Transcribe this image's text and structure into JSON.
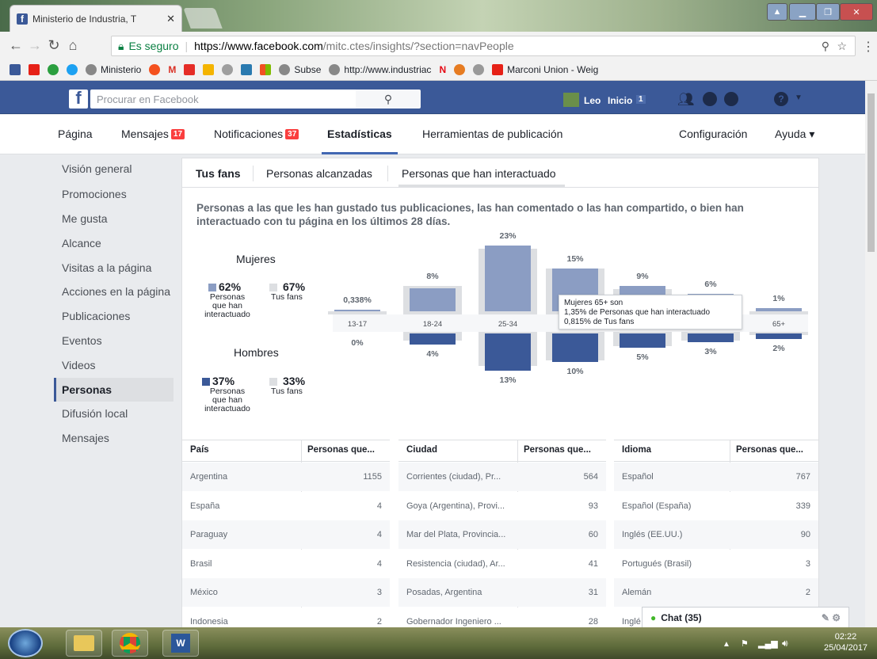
{
  "browser": {
    "tab_title": "Ministerio de Industria, T",
    "secure_label": "Es seguro",
    "url_host": "https://www.facebook.com",
    "url_rest": "/mitc.ctes/insights/?section=navPeople",
    "bookmarks": [
      "Ministerio",
      "Subse",
      "http://www.industriac",
      "Marconi Union - Weig"
    ]
  },
  "fb": {
    "search_placeholder": "Procurar en Facebook",
    "user": "Leo",
    "home": "Inicio",
    "home_count": "1"
  },
  "pagenav": {
    "pagina": "Página",
    "mensajes": "Mensajes",
    "mensajes_badge": "17",
    "notificaciones": "Notificaciones",
    "notificaciones_badge": "37",
    "estadisticas": "Estadísticas",
    "herramientas": "Herramientas de publicación",
    "configuracion": "Configuración",
    "ayuda": "Ayuda ▾"
  },
  "sidebar": [
    "Visión general",
    "Promociones",
    "Me gusta",
    "Alcance",
    "Visitas a la página",
    "Acciones en la página",
    "Publicaciones",
    "Eventos",
    "Videos",
    "Personas",
    "Difusión local",
    "Mensajes"
  ],
  "tabs": [
    "Tus fans",
    "Personas alcanzadas",
    "Personas que han interactuado"
  ],
  "description": "Personas a las que les han gustado tus publicaciones, las han comentado o las han compartido, o bien han interactuado con tu página en los últimos 28 días.",
  "legend": {
    "mujeres": "Mujeres",
    "hombres": "Hombres",
    "m_interact_pct": "62%",
    "m_fans_pct": "67%",
    "h_interact_pct": "37%",
    "h_fans_pct": "33%",
    "interact_label": "Personas que han interactuado",
    "fans_label": "Tus fans"
  },
  "chart_data": {
    "type": "bar",
    "categories": [
      "13-17",
      "18-24",
      "25-34",
      "35-44",
      "45-54",
      "55-64",
      "65+"
    ],
    "series": [
      {
        "name": "Mujeres",
        "labels": [
          "0,338%",
          "8%",
          "23%",
          "15%",
          "9%",
          "6%",
          "1%"
        ],
        "values": [
          0.338,
          8,
          23,
          15,
          9,
          6,
          1
        ]
      },
      {
        "name": "Hombres",
        "labels": [
          "0%",
          "4%",
          "13%",
          "10%",
          "5%",
          "3%",
          "2%"
        ],
        "values": [
          0,
          4,
          13,
          10,
          5,
          3,
          2
        ]
      }
    ],
    "tooltip": [
      "Mujeres 65+ son",
      "1,35% de Personas que han interactuado",
      "0,815% de Tus fans"
    ]
  },
  "colors": {
    "women": "#8b9dc3",
    "men": "#3b5998",
    "fans": "#dddfe2"
  },
  "tables": [
    {
      "h1": "País",
      "h2": "Personas que...",
      "rows": [
        [
          "Argentina",
          "1155"
        ],
        [
          "España",
          "4"
        ],
        [
          "Paraguay",
          "4"
        ],
        [
          "Brasil",
          "4"
        ],
        [
          "México",
          "3"
        ],
        [
          "Indonesia",
          "2"
        ]
      ]
    },
    {
      "h1": "Ciudad",
      "h2": "Personas que...",
      "rows": [
        [
          "Corrientes (ciudad), Pr...",
          "564"
        ],
        [
          "Goya (Argentina), Provi...",
          "93"
        ],
        [
          "Mar del Plata, Provincia...",
          "60"
        ],
        [
          "Resistencia (ciudad), Ar...",
          "41"
        ],
        [
          "Posadas, Argentina",
          "31"
        ],
        [
          "Gobernador Ingeniero ...",
          "28"
        ]
      ]
    },
    {
      "h1": "Idioma",
      "h2": "Personas que...",
      "rows": [
        [
          "Español",
          "767"
        ],
        [
          "Español (España)",
          "339"
        ],
        [
          "Inglés (EE.UU.)",
          "90"
        ],
        [
          "Portugués (Brasil)",
          "3"
        ],
        [
          "Alemán",
          "2"
        ],
        [
          "Inglé",
          ""
        ]
      ]
    }
  ],
  "chat": "Chat (35)",
  "clock": {
    "time": "02:22",
    "date": "25/04/2017"
  }
}
